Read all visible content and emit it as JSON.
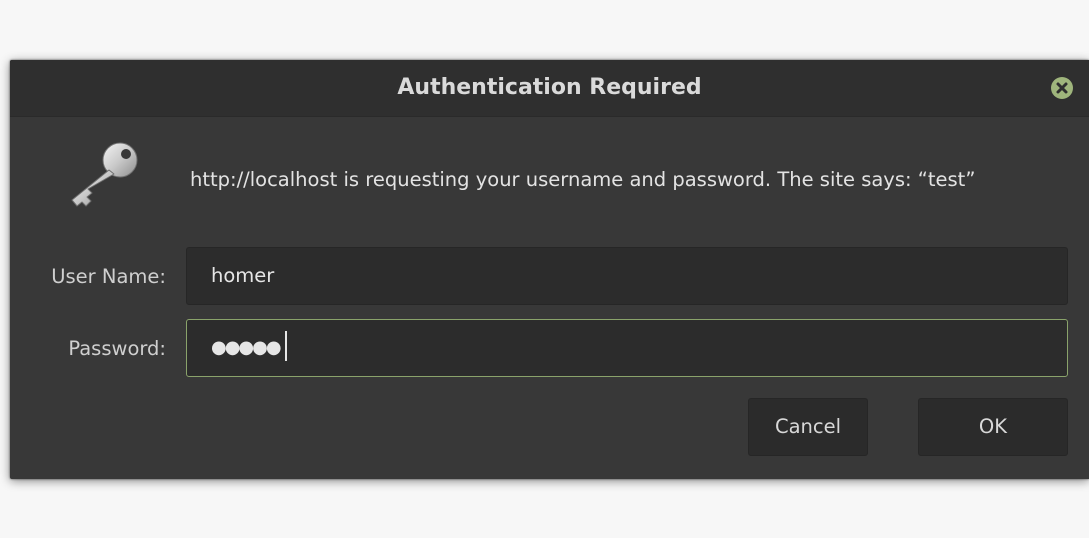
{
  "dialog": {
    "title": "Authentication Required",
    "message": "http://localhost is requesting your username and password. The site says: “test”",
    "icon": "key-icon",
    "close_icon": "close-icon"
  },
  "form": {
    "username_label": "User Name:",
    "username_value": "homer",
    "password_label": "Password:",
    "password_masked": "●●●●●"
  },
  "buttons": {
    "cancel_label": "Cancel",
    "ok_label": "OK"
  },
  "colors": {
    "dialog_bg": "#383838",
    "titlebar_bg": "#2f2f2f",
    "accent": "#8aa36b",
    "close_button": "#9fb57c"
  }
}
